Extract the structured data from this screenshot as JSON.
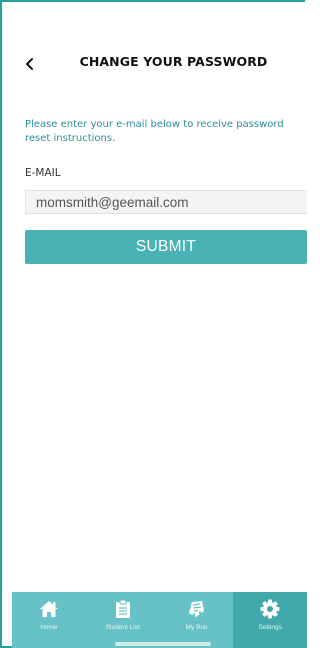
{
  "header": {
    "title": "CHANGE YOUR PASSWORD"
  },
  "form": {
    "instructions": "Please enter your e-mail below to receive password reset instructions.",
    "email_label": "E-MAIL",
    "email_value": "momsmith@geemail.com",
    "submit_label": "SUBMIT"
  },
  "tabbar": {
    "items": [
      {
        "label": "Home",
        "icon": "home-icon",
        "active": false
      },
      {
        "label": "Student List",
        "icon": "clipboard-icon",
        "active": false
      },
      {
        "label": "My Bus",
        "icon": "bus-icon",
        "active": false
      },
      {
        "label": "Settings",
        "icon": "gear-icon",
        "active": true
      }
    ]
  },
  "colors": {
    "accent": "#2aa09c",
    "button": "#48b2b4",
    "tabbar": "#66c2c6",
    "tabbar_active": "#40a9ab",
    "instructions_text": "#2b8e9a"
  }
}
